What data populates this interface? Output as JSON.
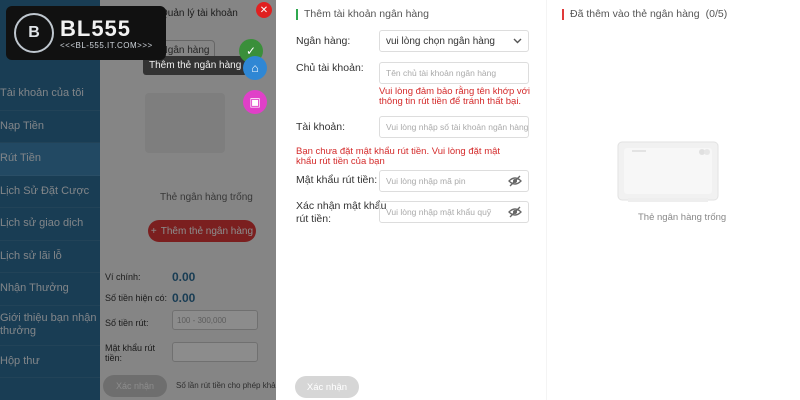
{
  "logo": {
    "mark": "B",
    "name": "BL555",
    "url": "<<<BL-555.IT.COM>>>"
  },
  "sidebar": {
    "items": [
      {
        "label": "Tài khoản của tôi"
      },
      {
        "label": "Nạp Tiền"
      },
      {
        "label": "Rút Tiền"
      },
      {
        "label": "Lịch Sử Đặt Cược"
      },
      {
        "label": "Lịch sử giao dịch"
      },
      {
        "label": "Lịch sử lãi lỗ"
      },
      {
        "label": "Nhận Thưởng"
      },
      {
        "label": "Giới thiệu bạn nhận thưởng"
      },
      {
        "label": "Hộp thư"
      }
    ]
  },
  "background_panel": {
    "header": "Quản lý tài khoản",
    "button_label": "Ngân hàng",
    "tooltip": "Thêm thẻ ngân hàng",
    "empty_text": "Thẻ ngân hàng trống",
    "add_button": "Thêm thẻ ngân hàng",
    "wallet_label": "Ví chính:",
    "wallet_value": "0.00",
    "withdrawable_label": "Số tiền hiện có:",
    "withdrawable_value": "0.00",
    "amount_label": "Số tiền rút:",
    "amount_placeholder": "100 - 300,000",
    "password_label": "Mật khẩu rút tiền:",
    "confirm_label": "Xác nhận",
    "note": "Số lần rút tiền cho phép khả dụng"
  },
  "form": {
    "title": "Thêm tài khoản ngân hàng",
    "bank_label": "Ngân hàng:",
    "bank_value": "vui lòng chọn ngân hàng",
    "holder_label": "Chủ tài khoản:",
    "holder_placeholder": "Tên chủ tài khoản ngân hàng",
    "holder_error_1": "Vui lòng đảm bảo rằng tên khớp với",
    "holder_error_2": "thông tin rút tiền để tránh thất bại.",
    "account_label": "Tài khoản:",
    "account_placeholder": "Vui lòng nhập số tài khoản ngân hàng",
    "pw_error_1": "Bạn chưa đặt mật khẩu rút tiền. Vui lòng đặt mật",
    "pw_error_2": "khẩu rút tiền của bạn",
    "pw_label": "Mật khẩu rút tiền:",
    "pw_placeholder": "Vui lòng nhập mã pin",
    "pw_confirm_label_1": "Xác nhận mật khẩu",
    "pw_confirm_label_2": "rút tiền:",
    "pw_confirm_placeholder": "Vui lòng nhập mật khẩu quỹ",
    "confirm_button": "Xác nhận"
  },
  "added": {
    "title": "Đã thêm vào thẻ ngân hàng",
    "count": "(0/5)",
    "empty_text": "Thẻ ngân hàng trống"
  },
  "colors": {
    "accent_green": "#2fa84f",
    "error_red": "#d42b2b",
    "sidebar_blue": "#2f6f99"
  }
}
